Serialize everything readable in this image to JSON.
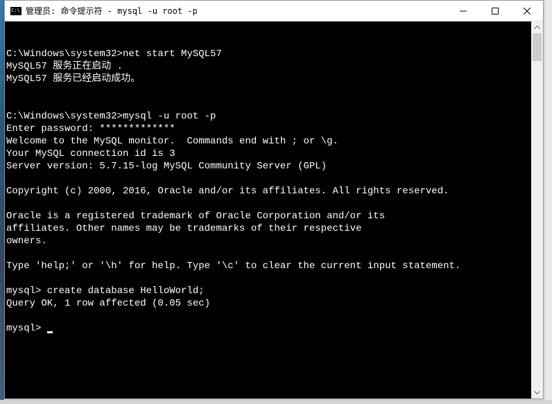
{
  "window": {
    "title": "管理员: 命令提示符 - mysql  -u root -p"
  },
  "terminal": {
    "lines": [
      "",
      "",
      "C:\\Windows\\system32>net start MySQL57",
      "MySQL57 服务正在启动 .",
      "MySQL57 服务已经启动成功。",
      "",
      "",
      "C:\\Windows\\system32>mysql -u root -p",
      "Enter password: *************",
      "Welcome to the MySQL monitor.  Commands end with ; or \\g.",
      "Your MySQL connection id is 3",
      "Server version: 5.7.15-log MySQL Community Server (GPL)",
      "",
      "Copyright (c) 2000, 2016, Oracle and/or its affiliates. All rights reserved.",
      "",
      "Oracle is a registered trademark of Oracle Corporation and/or its",
      "affiliates. Other names may be trademarks of their respective",
      "owners.",
      "",
      "Type 'help;' or '\\h' for help. Type '\\c' to clear the current input statement.",
      "",
      "mysql> create database HelloWorld;",
      "Query OK, 1 row affected (0.05 sec)",
      "",
      "mysql> "
    ]
  }
}
